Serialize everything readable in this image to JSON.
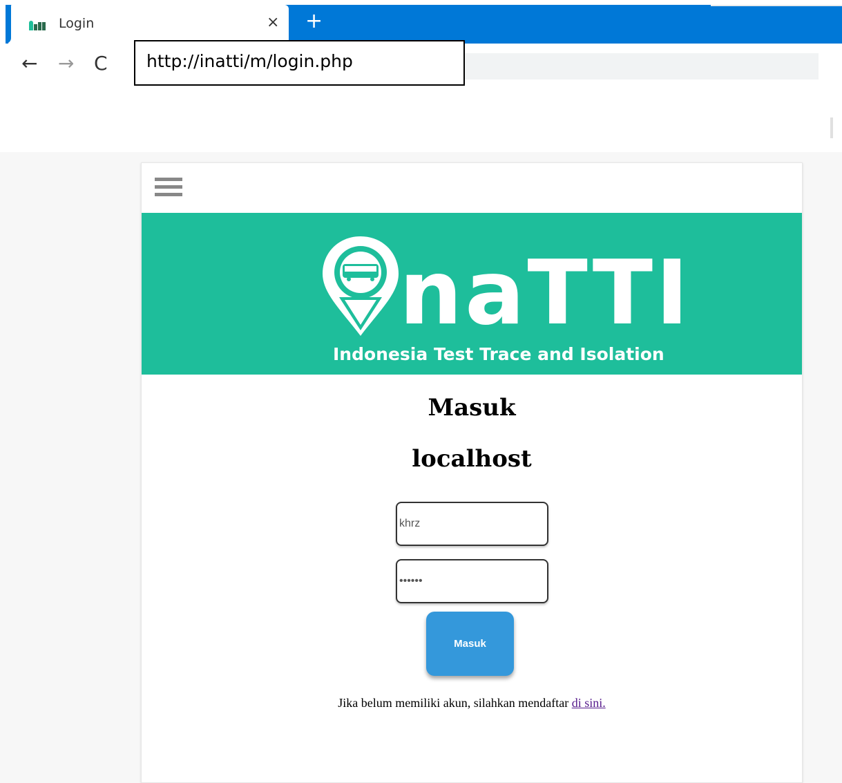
{
  "browser": {
    "tab_title": "Login",
    "tab_close": "×",
    "new_tab": "+",
    "nav_back": "←",
    "nav_forward": "→",
    "nav_reload": "C",
    "url": "http://inatti/m/login.php"
  },
  "page": {
    "brand_name": "naTTI",
    "brand_tagline": "Indonesia Test Trace and Isolation",
    "heading": "Masuk",
    "subheading": "localhost",
    "username_value": "khrz",
    "password_value": "••••••",
    "login_button": "Masuk",
    "register_text": "Jika belum memiliki akun, silahkan mendaftar ",
    "register_link": "di sini."
  },
  "colors": {
    "tab_bar": "#0078d7",
    "banner": "#1ebe9b",
    "button": "#3498db",
    "link_visited": "#551a8b"
  },
  "icons": {
    "menu": "hamburger-icon",
    "logo": "location-pin-bus-icon"
  }
}
